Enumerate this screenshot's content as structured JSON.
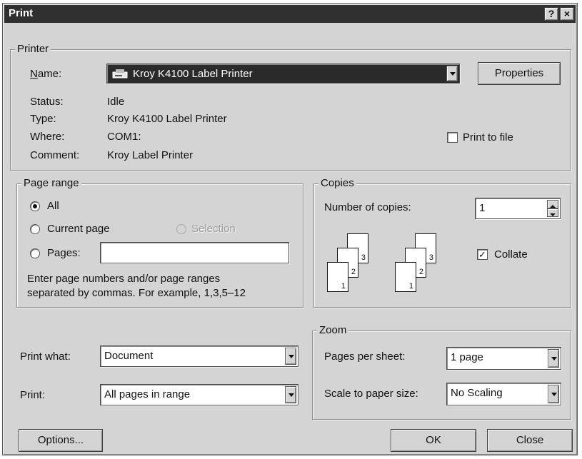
{
  "window": {
    "title": "Print",
    "help_label": "?",
    "close_label": "×"
  },
  "printer": {
    "legend": "Printer",
    "name_label": "Name:",
    "name_value": "Kroy K4100 Label Printer",
    "properties_label": "Properties",
    "status_label": "Status:",
    "status_value": "Idle",
    "type_label": "Type:",
    "type_value": "Kroy K4100 Label Printer",
    "where_label": "Where:",
    "where_value": "COM1:",
    "comment_label": "Comment:",
    "comment_value": "Kroy Label Printer",
    "print_to_file_label": "Print to file",
    "print_to_file_checked": false
  },
  "page_range": {
    "legend": "Page range",
    "all_label": "All",
    "current_page_label": "Current page",
    "selection_label": "Selection",
    "pages_label": "Pages:",
    "pages_value": "",
    "selected": "all",
    "hint_line1": "Enter page numbers and/or page ranges",
    "hint_line2": "separated by commas.  For example, 1,3,5–12"
  },
  "copies": {
    "legend": "Copies",
    "number_label": "Number of copies:",
    "number_value": "1",
    "collate_label": "Collate",
    "collate_checked": true,
    "page_numbers": [
      "3",
      "2",
      "1"
    ]
  },
  "print_what": {
    "label": "Print what:",
    "value": "Document"
  },
  "print": {
    "label": "Print:",
    "value": "All pages in range"
  },
  "zoom": {
    "legend": "Zoom",
    "pages_per_sheet_label": "Pages per sheet:",
    "pages_per_sheet_value": "1 page",
    "scale_label": "Scale to paper size:",
    "scale_value": "No Scaling"
  },
  "buttons": {
    "options": "Options...",
    "ok": "OK",
    "close": "Close"
  }
}
